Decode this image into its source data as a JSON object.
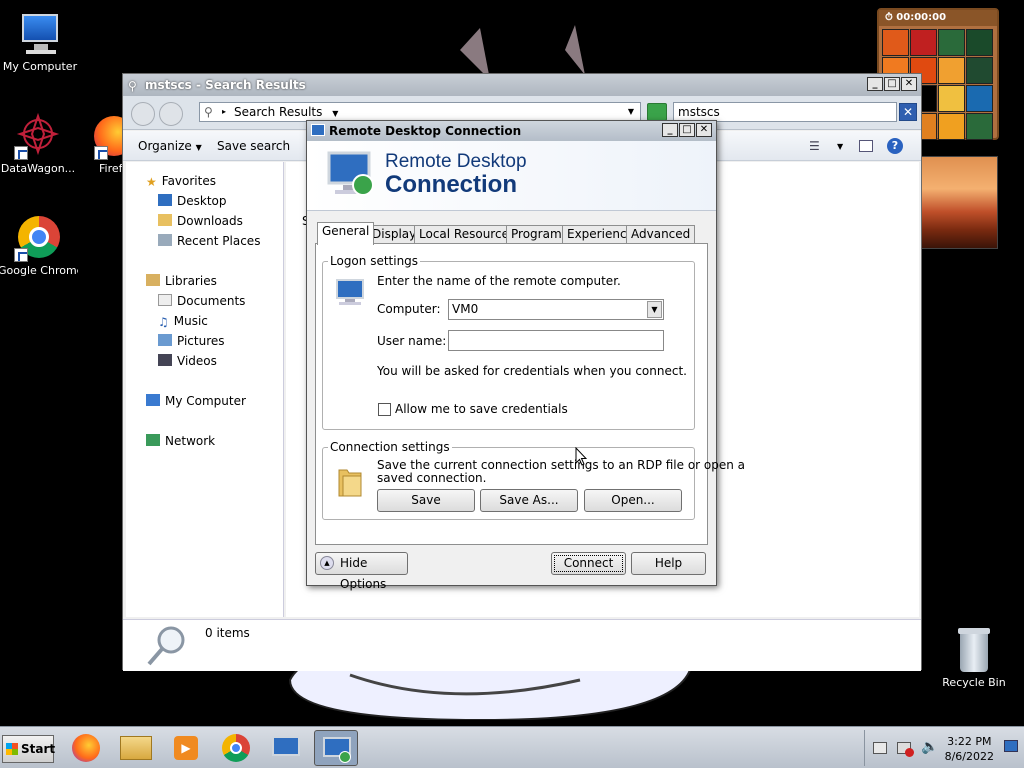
{
  "desktop": {
    "icons": [
      {
        "label": "My Computer"
      },
      {
        "label": "DataWagon..."
      },
      {
        "label": "Firef"
      },
      {
        "label": "Google Chrome"
      },
      {
        "label": "Recycle Bin"
      }
    ]
  },
  "gadget": {
    "timer": "00:00:00"
  },
  "explorer": {
    "title": "mstscs - Search Results",
    "address": "Search Results",
    "search_value": "mstscs",
    "search_clear": "✕",
    "commands": {
      "organize": "Organize",
      "save_search": "Save search"
    },
    "nav": {
      "favorites": "Favorites",
      "desktop": "Desktop",
      "downloads": "Downloads",
      "recent": "Recent Places",
      "libraries": "Libraries",
      "documents": "Documents",
      "music": "Music",
      "pictures": "Pictures",
      "videos": "Videos",
      "computer": "My Computer",
      "network": "Network"
    },
    "content_partial": "S",
    "status": "0 items"
  },
  "rdp": {
    "title": "Remote Desktop Connection",
    "banner_line1": "Remote Desktop",
    "banner_line2": "Connection",
    "tabs": [
      "General",
      "Display",
      "Local Resources",
      "Programs",
      "Experience",
      "Advanced"
    ],
    "logon": {
      "legend": "Logon settings",
      "prompt": "Enter the name of the remote computer.",
      "computer_label": "Computer:",
      "computer_value": "VM0",
      "username_label": "User name:",
      "username_value": "",
      "cred_note": "You will be asked for credentials when you connect.",
      "allow_save": "Allow me to save credentials"
    },
    "connection": {
      "legend": "Connection settings",
      "desc_line1": "Save the current connection settings to an RDP file or open a",
      "desc_line2": "saved connection.",
      "save": "Save",
      "save_as": "Save As...",
      "open": "Open..."
    },
    "hide_options": "Hide Options",
    "connect": "Connect",
    "help": "Help"
  },
  "taskbar": {
    "start": "Start",
    "time": "3:22 PM",
    "date": "8/6/2022"
  },
  "colors": {
    "accent": "#123a7a",
    "desktop_bg": "#000000"
  }
}
